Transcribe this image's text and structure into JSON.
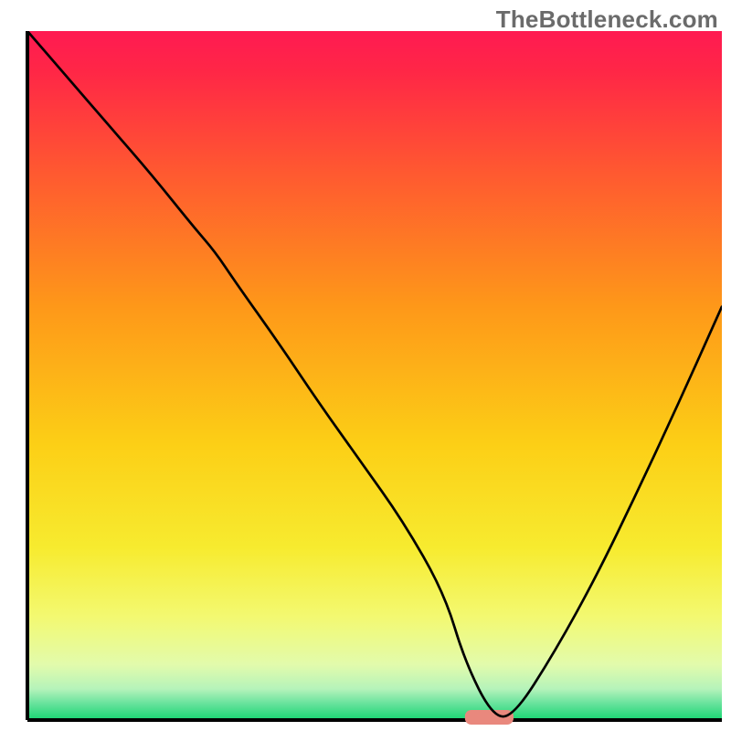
{
  "watermark": {
    "text": "TheBottleneck.com"
  },
  "chart_data": {
    "type": "line",
    "title": "",
    "xlabel": "",
    "ylabel": "",
    "xlim": [
      0,
      100
    ],
    "ylim": [
      0,
      100
    ],
    "background_gradient": {
      "stops": [
        {
          "offset": 0.0,
          "color": "#ff1a52"
        },
        {
          "offset": 0.06,
          "color": "#ff2746"
        },
        {
          "offset": 0.2,
          "color": "#ff5731"
        },
        {
          "offset": 0.4,
          "color": "#fe9819"
        },
        {
          "offset": 0.6,
          "color": "#fccf16"
        },
        {
          "offset": 0.75,
          "color": "#f7eb2f"
        },
        {
          "offset": 0.85,
          "color": "#f3f971"
        },
        {
          "offset": 0.92,
          "color": "#e2fbac"
        },
        {
          "offset": 0.955,
          "color": "#b5f3ba"
        },
        {
          "offset": 0.975,
          "color": "#6be39e"
        },
        {
          "offset": 1.0,
          "color": "#18d672"
        }
      ]
    },
    "notch": {
      "x_range": [
        63,
        70
      ],
      "y": 0,
      "color": "#e9887d",
      "approximate": true
    },
    "series": [
      {
        "name": "curve",
        "color": "#000000",
        "stroke_width": 2.7,
        "x": [
          0,
          6,
          12,
          18,
          24,
          27,
          30,
          36,
          42,
          48,
          54,
          60,
          63,
          67,
          70,
          76,
          82,
          88,
          94,
          100
        ],
        "y": [
          100,
          93,
          86,
          79,
          71.5,
          68,
          63.5,
          55,
          46,
          37.5,
          29,
          18.5,
          8.5,
          0.5,
          0.5,
          10,
          21,
          33.5,
          46.5,
          60
        ]
      }
    ]
  }
}
